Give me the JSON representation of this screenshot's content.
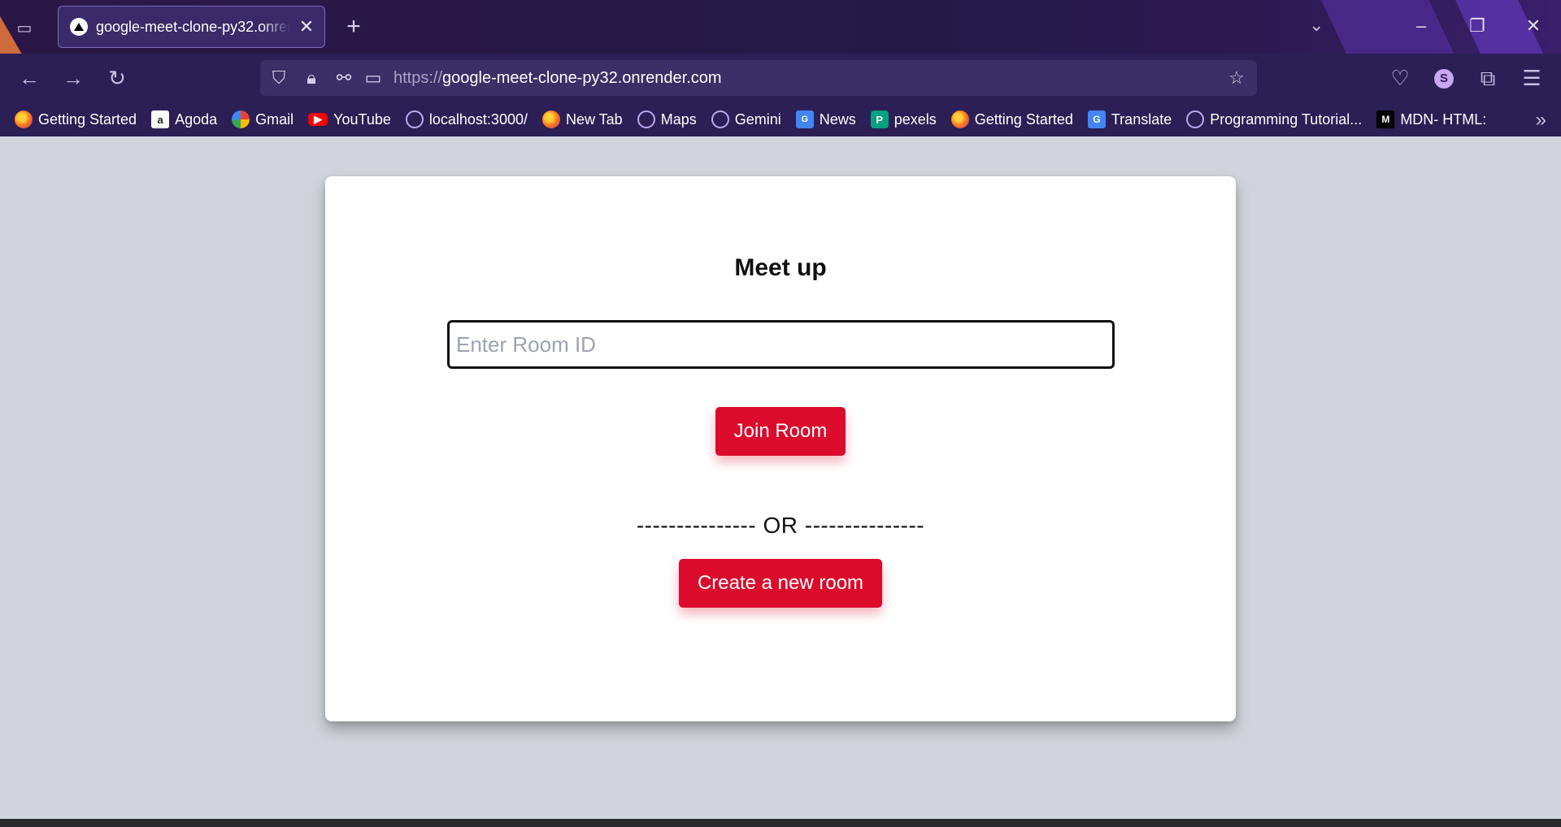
{
  "browser": {
    "tab": {
      "title": "google-meet-clone-py32.onrender.com"
    },
    "url": {
      "scheme": "https://",
      "host": "google-meet-clone-py32.onrender.com"
    },
    "profile_initial": "S",
    "bookmarks": [
      {
        "label": "Getting Started",
        "icon": "firefox-icon"
      },
      {
        "label": "Agoda",
        "icon": "agoda-icon"
      },
      {
        "label": "Gmail",
        "icon": "google-icon"
      },
      {
        "label": "YouTube",
        "icon": "youtube-icon"
      },
      {
        "label": "localhost:3000/",
        "icon": "globe-icon"
      },
      {
        "label": "New Tab",
        "icon": "firefox-icon"
      },
      {
        "label": "Maps",
        "icon": "globe-icon"
      },
      {
        "label": "Gemini",
        "icon": "globe-icon"
      },
      {
        "label": "News",
        "icon": "google-news-icon"
      },
      {
        "label": "pexels",
        "icon": "pexels-icon"
      },
      {
        "label": "Getting Started",
        "icon": "firefox-icon"
      },
      {
        "label": "Translate",
        "icon": "google-translate-icon"
      },
      {
        "label": "Programming Tutorial...",
        "icon": "globe-icon"
      },
      {
        "label": "MDN- HTML:",
        "icon": "mdn-icon"
      }
    ]
  },
  "main": {
    "title": "Meet up",
    "room_input": {
      "placeholder": "Enter Room ID",
      "value": ""
    },
    "join_label": "Join Room",
    "divider_text": "--------------- OR ---------------",
    "create_label": "Create a new room"
  },
  "colors": {
    "accent": "#dc0a2d",
    "page_background": "#d1d5db",
    "browser_chrome": "#2b1f55"
  }
}
